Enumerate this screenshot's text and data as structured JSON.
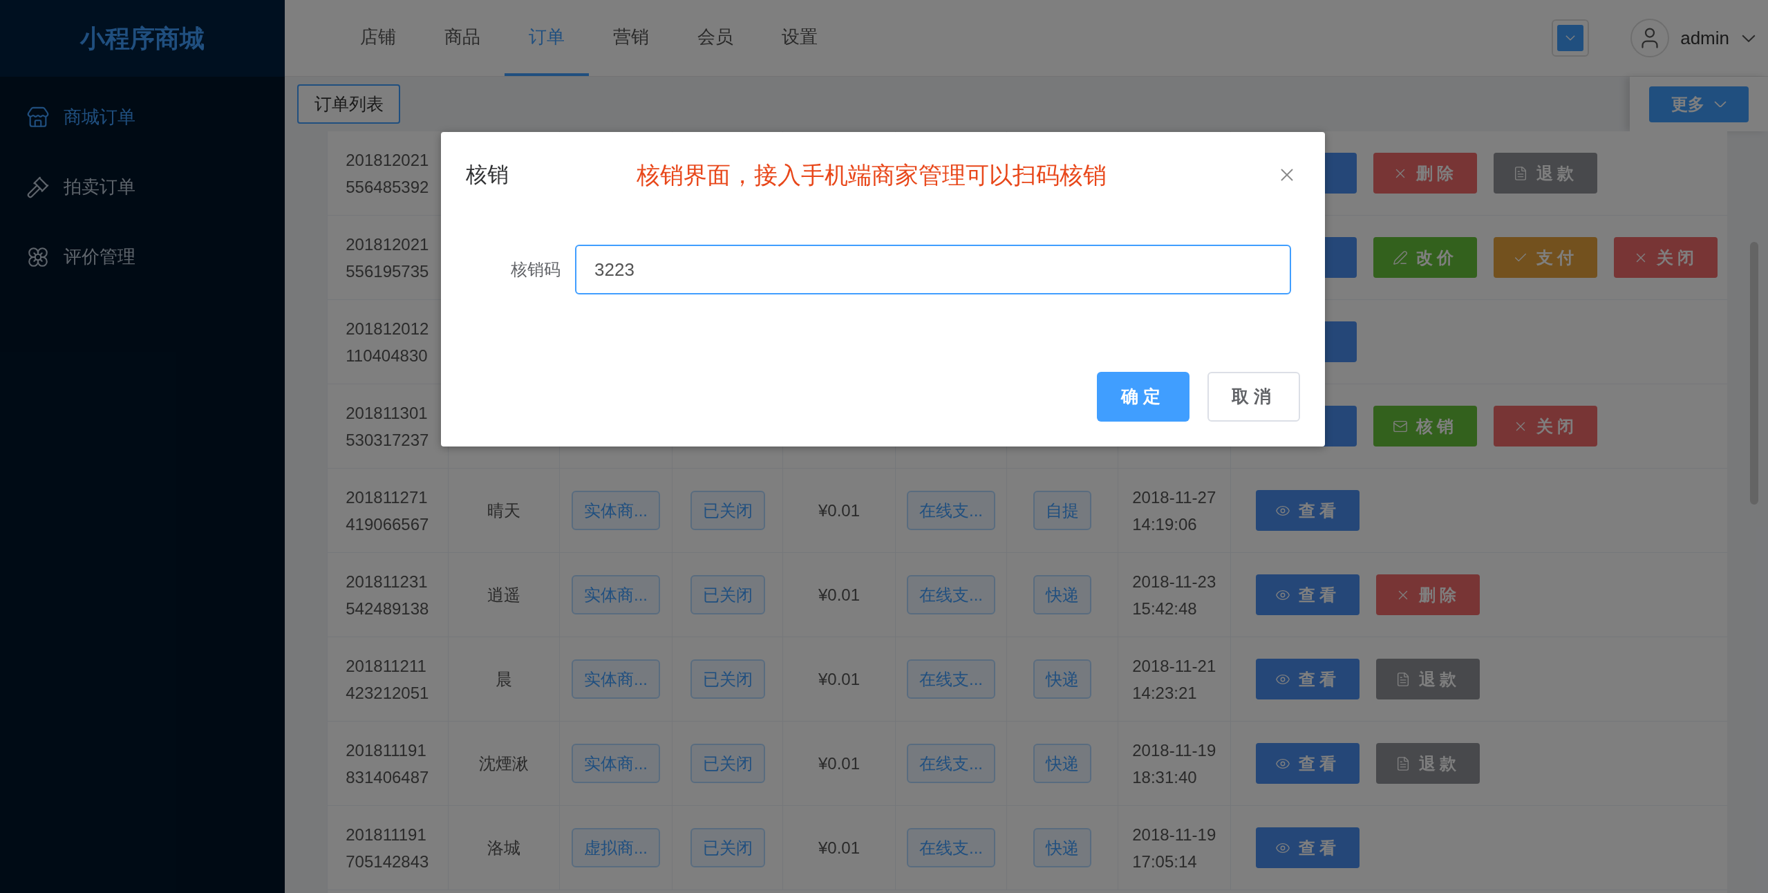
{
  "app": {
    "logo": "小程序商城"
  },
  "sidebar": {
    "items": [
      {
        "label": "商城订单",
        "selected": true
      },
      {
        "label": "拍卖订单",
        "selected": false
      },
      {
        "label": "评价管理",
        "selected": false
      }
    ]
  },
  "top_nav": {
    "tabs": [
      {
        "label": "店铺",
        "selected": false
      },
      {
        "label": "商品",
        "selected": false
      },
      {
        "label": "订单",
        "selected": true
      },
      {
        "label": "营销",
        "selected": false
      },
      {
        "label": "会员",
        "selected": false
      },
      {
        "label": "设置",
        "selected": false
      }
    ]
  },
  "header": {
    "user": "admin"
  },
  "subnav": {
    "tabs": [
      {
        "label": "订单列表",
        "selected": true
      }
    ],
    "more_button": "更多"
  },
  "orders": [
    {
      "id": "201812021556485392",
      "actions": [
        {
          "kind": "view"
        },
        {
          "kind": "delete",
          "label": "删除"
        },
        {
          "kind": "refund",
          "label": "退款"
        }
      ]
    },
    {
      "id": "201812021556195735",
      "actions": [
        {
          "kind": "view"
        },
        {
          "kind": "edit_price",
          "label": "改价"
        },
        {
          "kind": "pay",
          "label": "支付"
        },
        {
          "kind": "close",
          "label": "关闭"
        }
      ]
    },
    {
      "id": "201812012110404830",
      "actions": [
        {
          "kind": "view"
        }
      ]
    },
    {
      "id": "201811301530317237",
      "actions": [
        {
          "kind": "view"
        },
        {
          "kind": "verify",
          "label": "核销"
        },
        {
          "kind": "close",
          "label": "关闭"
        }
      ]
    },
    {
      "id": "201811271419066567",
      "customer": "晴天",
      "goods_type": "实体商...",
      "status": "已关闭",
      "amount": "¥0.01",
      "payment": "在线支...",
      "delivery": "自提",
      "time": "2018-11-27 14:19:06",
      "actions": [
        {
          "kind": "view",
          "label": "查看"
        }
      ]
    },
    {
      "id": "201811231542489138",
      "customer": "逍遥",
      "goods_type": "实体商...",
      "status": "已关闭",
      "amount": "¥0.01",
      "payment": "在线支...",
      "delivery": "快递",
      "time": "2018-11-23 15:42:48",
      "actions": [
        {
          "kind": "view",
          "label": "查看"
        },
        {
          "kind": "delete",
          "label": "删除"
        }
      ]
    },
    {
      "id": "201811211423212051",
      "customer": "晨",
      "goods_type": "实体商...",
      "status": "已关闭",
      "amount": "¥0.01",
      "payment": "在线支...",
      "delivery": "快递",
      "time": "2018-11-21 14:23:21",
      "actions": [
        {
          "kind": "view",
          "label": "查看"
        },
        {
          "kind": "refund",
          "label": "退款"
        }
      ]
    },
    {
      "id": "201811191831406487",
      "customer": "沈煙湫",
      "goods_type": "实体商...",
      "status": "已关闭",
      "amount": "¥0.01",
      "payment": "在线支...",
      "delivery": "快递",
      "time": "2018-11-19 18:31:40",
      "actions": [
        {
          "kind": "view",
          "label": "查看"
        },
        {
          "kind": "refund",
          "label": "退款"
        }
      ]
    },
    {
      "id": "201811191705142843",
      "customer": "洛城",
      "goods_type": "虚拟商...",
      "status": "已关闭",
      "amount": "¥0.01",
      "payment": "在线支...",
      "delivery": "快递",
      "time": "2018-11-19 17:05:14",
      "actions": [
        {
          "kind": "view",
          "label": "查看"
        }
      ]
    }
  ],
  "dialog": {
    "title": "核销",
    "note": "核销界面，接入手机端商家管理可以扫码核销",
    "field": {
      "label": "核销码",
      "value": "3223"
    },
    "buttons": [
      {
        "kind": "primary",
        "label": "确定"
      },
      {
        "kind": "default",
        "label": "取消"
      }
    ]
  }
}
